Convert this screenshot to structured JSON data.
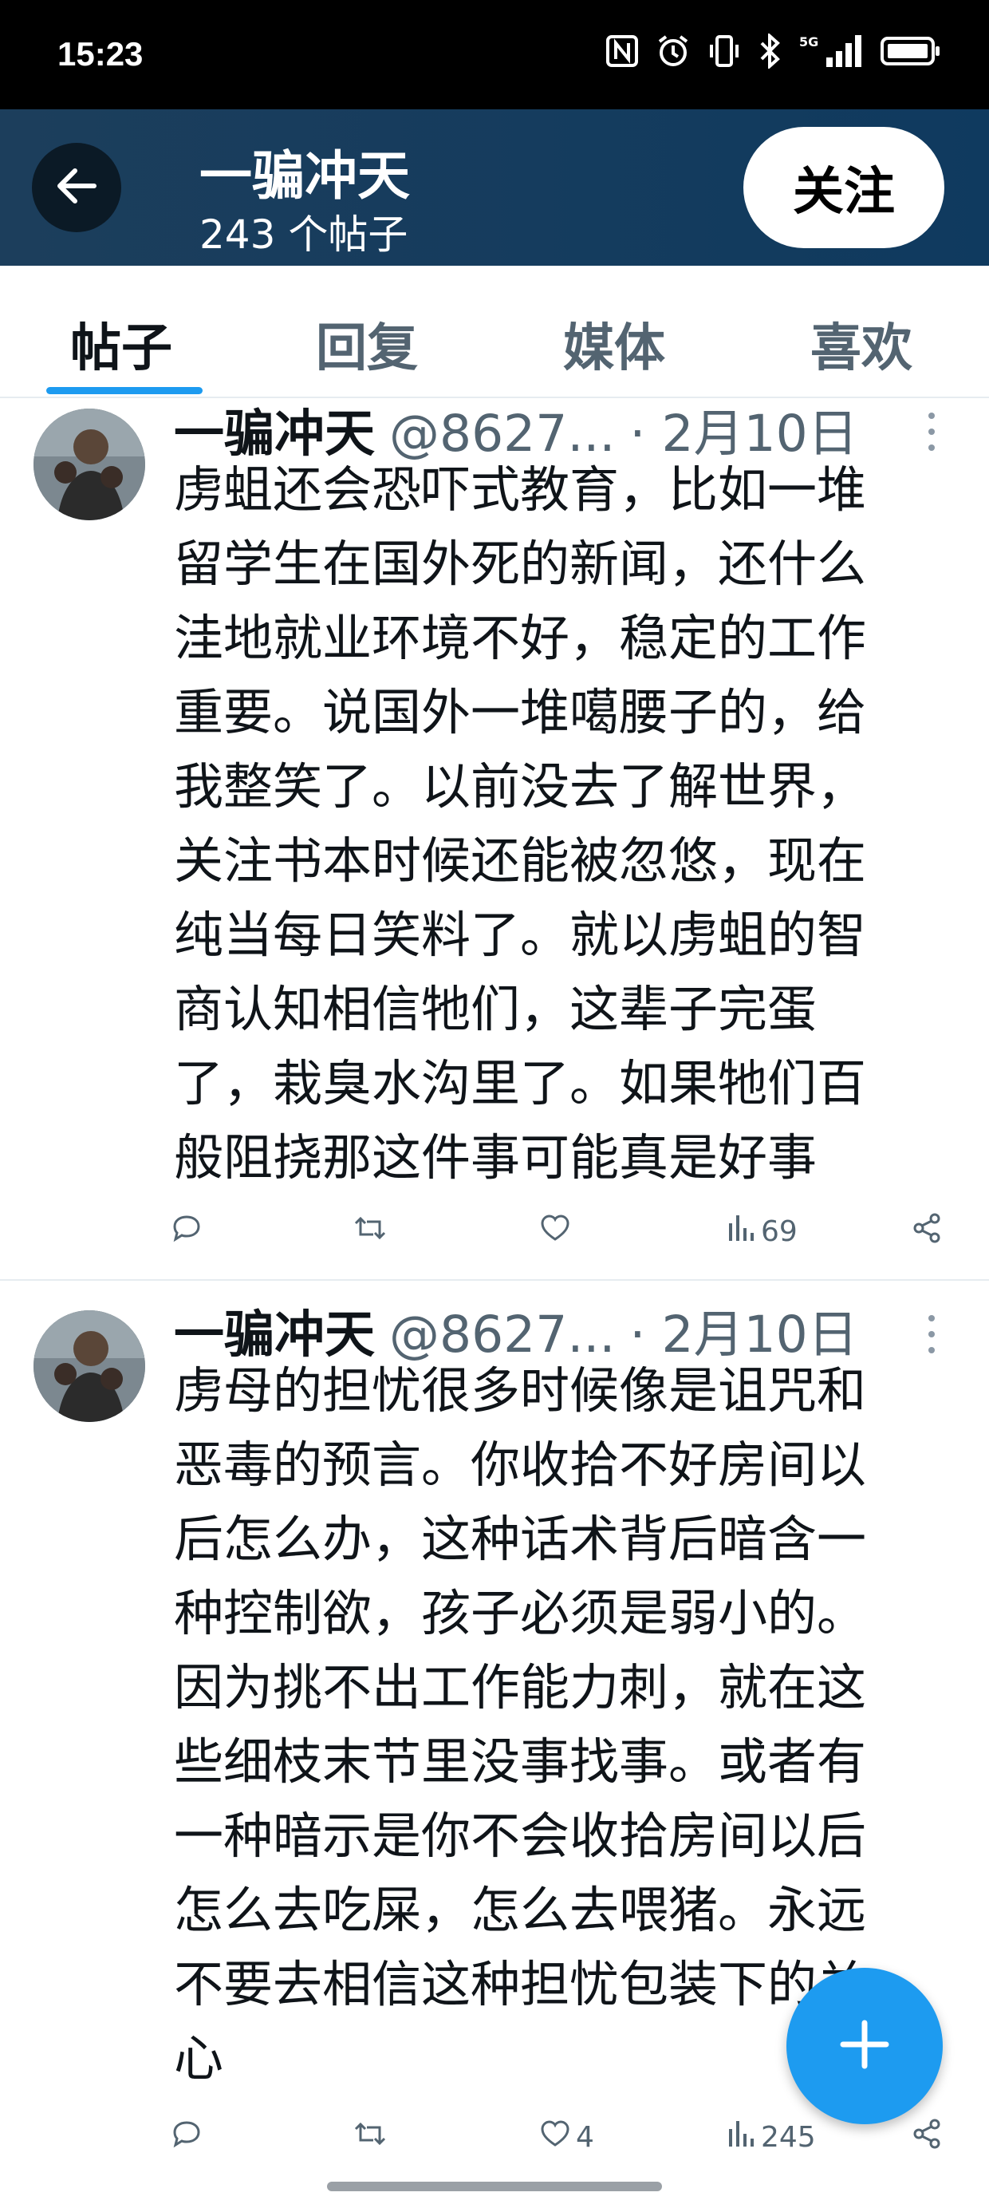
{
  "status_bar": {
    "time": "15:23",
    "icons": [
      "nfc-icon",
      "alarm-icon",
      "vibrate-icon",
      "bluetooth-icon",
      "signal-5g-icon",
      "battery-icon"
    ],
    "network": "5G"
  },
  "header": {
    "title": "一骗冲天",
    "subtitle": "243 个帖子",
    "follow_label": "关注",
    "background": "#1c3e5c"
  },
  "tabs": [
    {
      "label": "帖子",
      "active": true
    },
    {
      "label": "回复",
      "active": false
    },
    {
      "label": "媒体",
      "active": false
    },
    {
      "label": "喜欢",
      "active": false
    }
  ],
  "accent_color": "#1d9bf0",
  "posts": [
    {
      "author": "一骗冲天",
      "handle": "@8627...",
      "date": "· 2月10日",
      "lines": [
        "虏蛆还会恐吓式教育，比如一堆",
        "留学生在国外死的新闻，还什么",
        "洼地就业环境不好，稳定的工作",
        "重要。说国外一堆噶腰子的，给",
        "我整笑了。以前没去了解世界，",
        "关注书本时候还能被忽悠，现在",
        "纯当每日笑料了。就以虏蛆的智",
        "商认知相信牠们，这辈子完蛋",
        "了，栽臭水沟里了。如果牠们百",
        "般阻挠那这件事可能真是好事"
      ],
      "replies": "",
      "reposts": "",
      "likes": "",
      "views": "69"
    },
    {
      "author": "一骗冲天",
      "handle": "@8627...",
      "date": "· 2月10日",
      "lines": [
        "虏母的担忧很多时候像是诅咒和",
        "恶毒的预言。你收拾不好房间以",
        "后怎么办，这种话术背后暗含一",
        "种控制欲，孩子必须是弱小的。",
        "因为挑不出工作能力刺，就在这",
        "些细枝末节里没事找事。或者有",
        "一种暗示是你不会收拾房间以后",
        "怎么去吃屎，怎么去喂猪。永远",
        "不要去相信这种担忧包装下的关",
        "心"
      ],
      "replies": "",
      "reposts": "",
      "likes": "4",
      "views": "245"
    }
  ]
}
